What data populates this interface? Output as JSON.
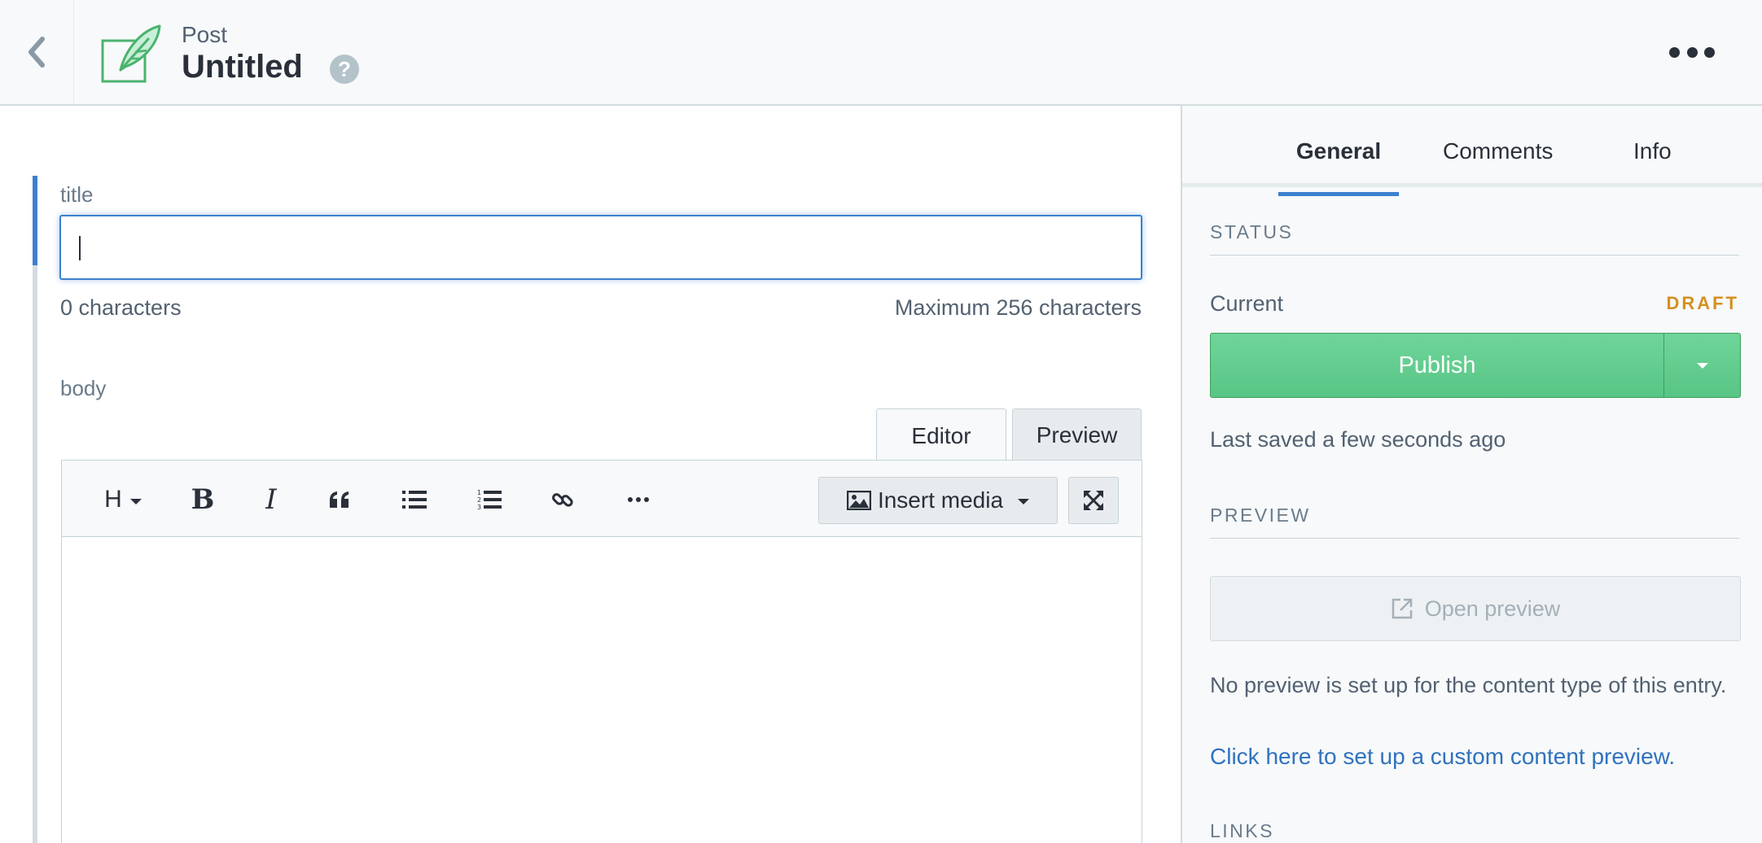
{
  "header": {
    "content_type": "Post",
    "title": "Untitled",
    "help_symbol": "?"
  },
  "fields": {
    "title": {
      "label": "title",
      "value": "",
      "char_count": "0 characters",
      "char_max": "Maximum 256 characters"
    },
    "body": {
      "label": "body",
      "tabs": {
        "editor": "Editor",
        "preview": "Preview"
      },
      "toolbar": {
        "heading": "H",
        "bold": "B",
        "italic": "I",
        "insert_media": "Insert media"
      }
    }
  },
  "sidebar": {
    "tabs": {
      "general": "General",
      "comments": "Comments",
      "info": "Info"
    },
    "status": {
      "heading": "STATUS",
      "current_label": "Current",
      "badge": "DRAFT",
      "publish_label": "Publish",
      "last_saved": "Last saved a few seconds ago"
    },
    "preview": {
      "heading": "PREVIEW",
      "open_label": "Open preview",
      "note": "No preview is set up for the content type of this entry.",
      "setup_link": "Click here to set up a custom content preview."
    },
    "links": {
      "heading": "LINKS"
    }
  },
  "colors": {
    "accent": "#3c80cf",
    "publish": "#5cc88a",
    "draft": "#d59020",
    "link": "#3072be"
  },
  "icons": [
    "chevron-left-icon",
    "feather-icon",
    "help-icon",
    "ellipsis-icon",
    "quote-icon",
    "bulleted-list-icon",
    "numbered-list-icon",
    "link-icon",
    "image-icon",
    "fullscreen-icon",
    "external-link-icon"
  ]
}
